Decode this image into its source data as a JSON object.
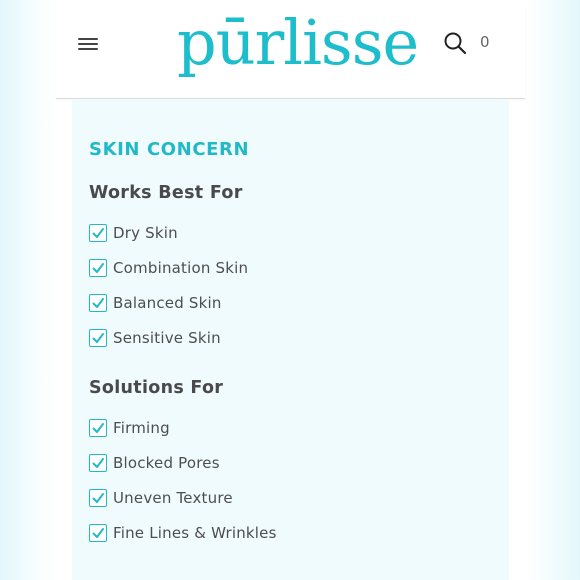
{
  "header": {
    "logo_text": "pūrlisse",
    "cart_count": "0",
    "menu_icon": "hamburger-menu-icon",
    "search_icon": "search-icon"
  },
  "filters": {
    "section_title": "SKIN CONCERN",
    "groups": [
      {
        "title": "Works Best For",
        "options": [
          {
            "label": "Dry Skin",
            "checked": true
          },
          {
            "label": "Combination Skin",
            "checked": true
          },
          {
            "label": "Balanced Skin",
            "checked": true
          },
          {
            "label": "Sensitive Skin",
            "checked": true
          }
        ]
      },
      {
        "title": "Solutions For",
        "options": [
          {
            "label": "Firming",
            "checked": true
          },
          {
            "label": "Blocked Pores",
            "checked": true
          },
          {
            "label": "Uneven Texture",
            "checked": true
          },
          {
            "label": "Fine Lines & Wrinkles",
            "checked": true
          }
        ]
      }
    ]
  },
  "colors": {
    "brand": "#1ebdcc",
    "panel_bg": "#f0fbfd",
    "text": "#4e4e4e"
  }
}
